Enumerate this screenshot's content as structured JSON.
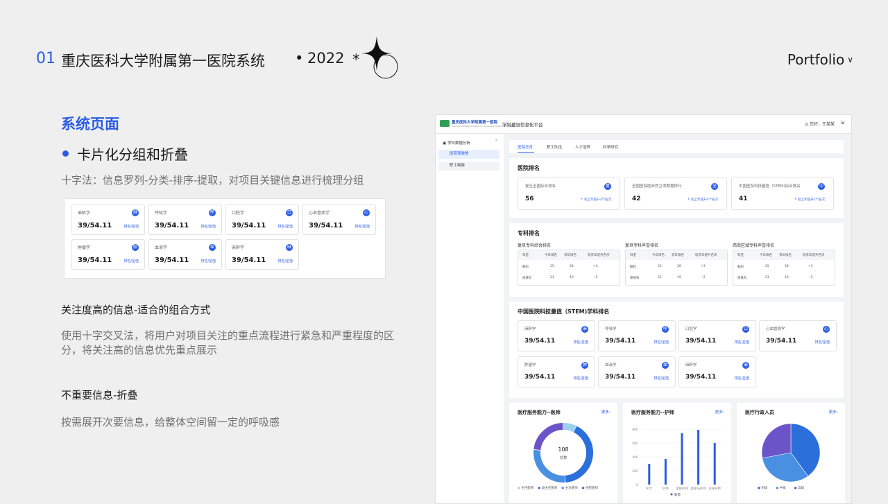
{
  "header": {
    "number": "01",
    "title": "重庆医科大学附属第一医院系统",
    "dot": "•",
    "year": "2022",
    "asterisk": "*",
    "portfolio": "Portfolio"
  },
  "left": {
    "section_title": "系统页面",
    "bullet": "卡片化分组和折叠",
    "desc1": "十字法：信息罗列-分类-排序-提取，对项目关键信息进行梳理分组",
    "h3": "关注度高的信息-适合的组合方式",
    "desc2": "使用十字交叉法，将用户对项目关注的重点流程进行紧急和严重程度的区分，将关注高的信息优先重点展示",
    "h4": "不重要信息-折叠",
    "desc3": "按需展开次要信息，给整体空间留一定的呼吸感"
  },
  "mini_cards": [
    {
      "name": "麻醉学",
      "value": "39/54.11",
      "link": "排名/星值",
      "icon": "麻"
    },
    {
      "name": "呼吸学",
      "value": "39/54.11",
      "link": "排名/星值",
      "icon": "呼"
    },
    {
      "name": "口腔学",
      "value": "39/54.11",
      "link": "排名/星值",
      "icon": "口"
    },
    {
      "name": "心血管病学",
      "value": "39/54.11",
      "link": "排名/星值",
      "icon": "心"
    },
    {
      "name": "肿瘤学",
      "value": "39/54.11",
      "link": "排名/星值",
      "icon": "肿"
    },
    {
      "name": "血液学",
      "value": "39/54.11",
      "link": "排名/星值",
      "icon": "血"
    },
    {
      "name": "麻醉学",
      "value": "39/54.11",
      "link": "排名/星值",
      "icon": "麻"
    }
  ],
  "app": {
    "logo_text": "重庆医科大学附属第一医院",
    "logo_sub": "The First Affiliated Hospital of Chongqing Medical University",
    "name": "学科建设信息化平台",
    "user": "您好，王某某",
    "exit_icon": "⇲",
    "sidebar": {
      "group": "学科数据分析",
      "items": [
        "医院驾驶舱",
        "职工画像"
      ]
    },
    "tabs": [
      "医院总览",
      "职工队伍",
      "人才培养",
      "科学研究"
    ],
    "hospital_rank": {
      "title": "医院排名",
      "cards": [
        {
          "name": "复旦全国综合排名",
          "value": "56",
          "change": "↑ 较上年提升3个名次",
          "icon": "复"
        },
        {
          "name": "全国医院医自然立项数据排行",
          "value": "42",
          "change": "↑ 较上年提升4个名次",
          "icon": "全"
        },
        {
          "name": "中国医院科技量值（STEM)综合排名",
          "value": "41",
          "change": "↑ 较上年提升2个名次",
          "icon": "中"
        }
      ]
    },
    "specialty_rank": {
      "title": "专科排名",
      "tables": [
        {
          "title": "复旦专科综合排名"
        },
        {
          "title": "复旦专科声誉排名"
        },
        {
          "title": "西南区域专科声誉排名"
        }
      ],
      "headers": [
        "科室",
        "今年排名",
        "去年排名",
        "较去年提升名次"
      ],
      "rows": [
        [
          "脑科",
          "25",
          "28",
          "+3"
        ],
        [
          "皮肤科",
          "21",
          "19",
          "−2"
        ]
      ]
    },
    "stem_rank": {
      "title": "中国医院科技量值（STEM)学科排名",
      "cards": [
        {
          "name": "麻醉学",
          "value": "39/54.11",
          "link": "排名/星值",
          "icon": "麻"
        },
        {
          "name": "呼吸学",
          "value": "39/54.11",
          "link": "排名/星值",
          "icon": "呼"
        },
        {
          "name": "口腔学",
          "value": "39/54.11",
          "link": "排名/星值",
          "icon": "口"
        },
        {
          "name": "心血管病学",
          "value": "39/54.11",
          "link": "排名/星值",
          "icon": "心"
        },
        {
          "name": "肿瘤学",
          "value": "39/54.11",
          "link": "排名/星值",
          "icon": "肿"
        },
        {
          "name": "血液学",
          "value": "39/54.11",
          "link": "排名/星值",
          "icon": "血"
        },
        {
          "name": "麻醉学",
          "value": "39/54.11",
          "link": "排名/星值",
          "icon": "麻"
        }
      ]
    },
    "bottom_panels": [
      {
        "title": "医疗服务能力--医师",
        "more": "更多›"
      },
      {
        "title": "医疗服务能力--护师",
        "more": "更多›"
      },
      {
        "title": "医疗行政人员",
        "more": "更多›"
      }
    ],
    "doctor_donut": {
      "center_value": "108",
      "center_label": "总数",
      "legend": [
        "主任医师",
        "副主任医师",
        "主治医师",
        "住院医师"
      ]
    }
  },
  "chart_data": [
    {
      "type": "pie",
      "title": "医疗服务能力--医师",
      "categories": [
        "主任医师",
        "副主任医师",
        "主治医师",
        "住院医师"
      ],
      "values": [
        8,
        45,
        30,
        25
      ],
      "colors": [
        "#9bd0f0",
        "#2b6fdb",
        "#4a90e2",
        "#6b54c8"
      ]
    },
    {
      "type": "bar",
      "title": "医疗服务能力--护师",
      "categories": [
        "护士",
        "护师",
        "主管护师",
        "副主任护师",
        "主任护师"
      ],
      "values": [
        300,
        370,
        740,
        790,
        600
      ],
      "ylim": [
        0,
        800
      ],
      "yticks": [
        "0",
        "200",
        "400",
        "600",
        "800"
      ],
      "legend": "数量",
      "color": "#2b5ce6"
    },
    {
      "type": "pie",
      "title": "医疗行政人员",
      "categories": [
        "初级",
        "中级",
        "高级"
      ],
      "values": [
        40,
        32,
        28
      ],
      "colors": [
        "#2b6fdb",
        "#4a90e2",
        "#6b54c8"
      ]
    }
  ]
}
